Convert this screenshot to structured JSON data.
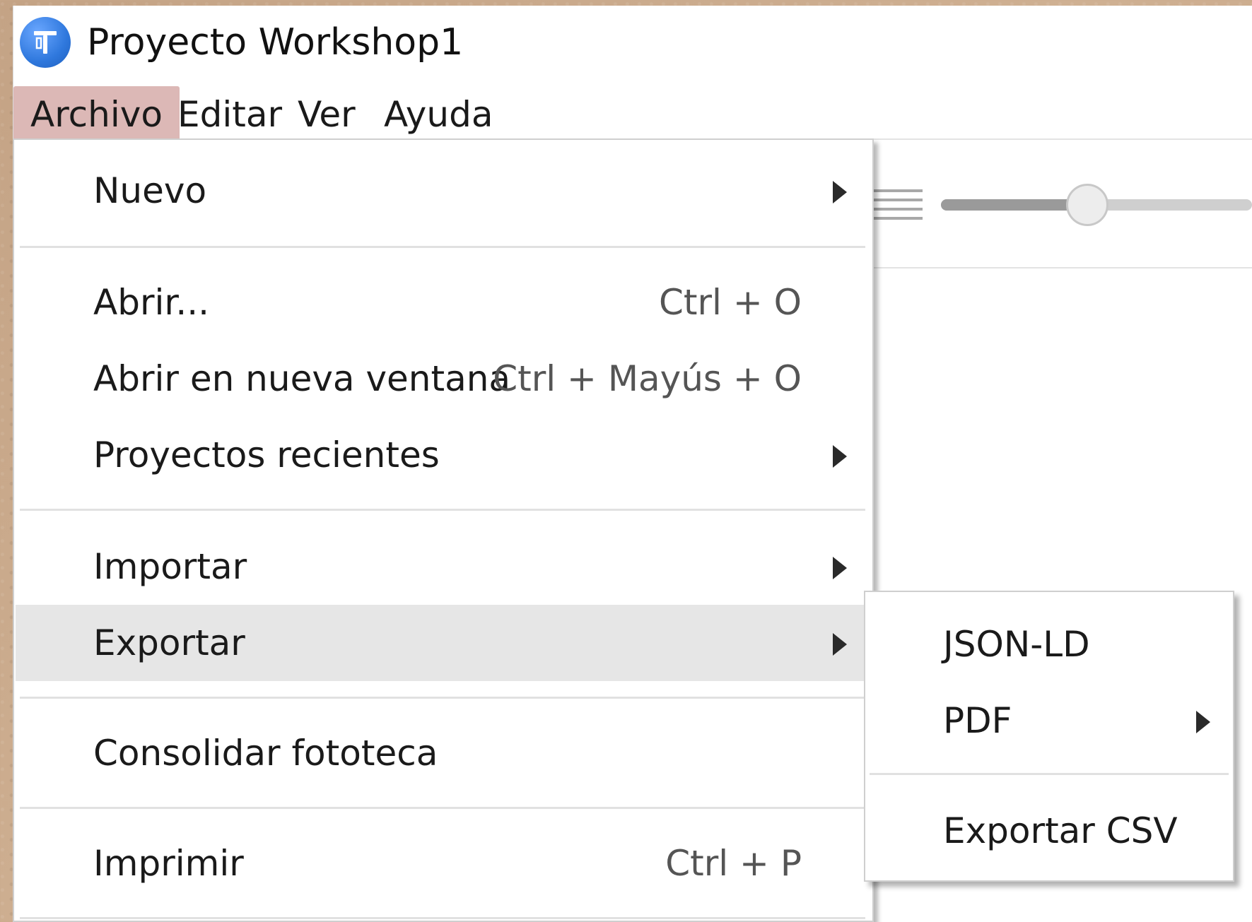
{
  "window": {
    "title": "Proyecto Workshop1",
    "app_icon": "app-logo-icon",
    "accent_color": "#2f78dd"
  },
  "menubar": {
    "items": [
      {
        "label": "Archivo",
        "active": true
      },
      {
        "label": "Editar",
        "active": false
      },
      {
        "label": "Ver",
        "active": false
      },
      {
        "label": "Ayuda",
        "active": false
      }
    ],
    "active_color": "#dcb8b6"
  },
  "toolbar": {
    "list_icon": "list-view-icon",
    "zoom_slider_fraction": 0.47
  },
  "archivo_menu": {
    "items": [
      {
        "label": "Nuevo",
        "shortcut": "",
        "submenu": true
      },
      {
        "label": "Abrir...",
        "shortcut": "Ctrl + O",
        "submenu": false
      },
      {
        "label": "Abrir en nueva ventana",
        "shortcut": "Ctrl + Mayús + O",
        "submenu": false
      },
      {
        "label": "Proyectos recientes",
        "shortcut": "",
        "submenu": true
      },
      {
        "label": "Importar",
        "shortcut": "",
        "submenu": true
      },
      {
        "label": "Exportar",
        "shortcut": "",
        "submenu": true,
        "highlighted": true
      },
      {
        "label": "Consolidar fototeca",
        "shortcut": "",
        "submenu": false
      },
      {
        "label": "Imprimir",
        "shortcut": "Ctrl + P",
        "submenu": false
      }
    ]
  },
  "exportar_submenu": {
    "items": [
      {
        "label": "JSON-LD",
        "submenu": false
      },
      {
        "label": "PDF",
        "submenu": true
      },
      {
        "label": "Exportar CSV",
        "submenu": false
      }
    ]
  }
}
